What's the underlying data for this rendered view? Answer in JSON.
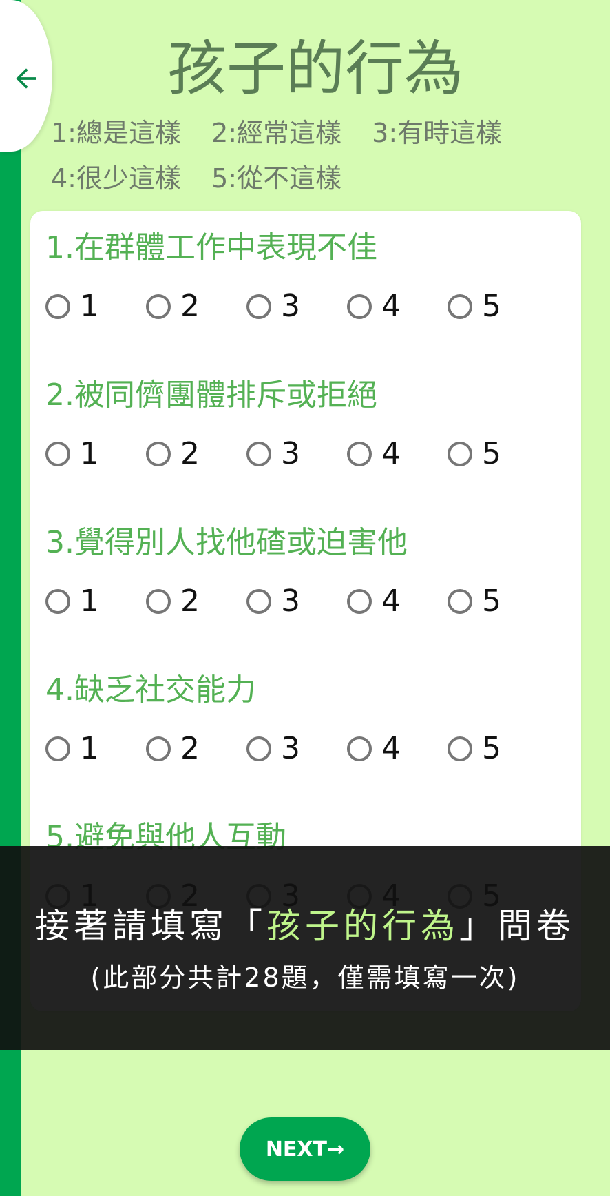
{
  "header": {
    "title": "孩子的行為",
    "legend": [
      [
        "1:總是這樣",
        "2:經常這樣",
        "3:有時這樣"
      ],
      [
        "4:很少這樣",
        "5:從不這樣"
      ]
    ]
  },
  "questions": [
    {
      "text": "1.在群體工作中表現不佳",
      "options": [
        "1",
        "2",
        "3",
        "4",
        "5"
      ]
    },
    {
      "text": "2.被同儕團體排斥或拒絕",
      "options": [
        "1",
        "2",
        "3",
        "4",
        "5"
      ]
    },
    {
      "text": "3.覺得別人找他碴或迫害他",
      "options": [
        "1",
        "2",
        "3",
        "4",
        "5"
      ]
    },
    {
      "text": "4.缺乏社交能力",
      "options": [
        "1",
        "2",
        "3",
        "4",
        "5"
      ]
    },
    {
      "text": "5.避免與他人互動",
      "options": [
        "1",
        "2",
        "3",
        "4",
        "5"
      ]
    }
  ],
  "overlay": {
    "line1_prefix": "接著請填寫「",
    "line1_highlight": "孩子的行為",
    "line1_suffix": "」問卷",
    "line2": "(此部分共計28題，僅需填寫一次)"
  },
  "footer": {
    "next_label": "NEXT→"
  },
  "colors": {
    "background": "#d6fbb3",
    "accent": "#00a650",
    "question_text": "#54b154",
    "title": "#5a7d55"
  }
}
